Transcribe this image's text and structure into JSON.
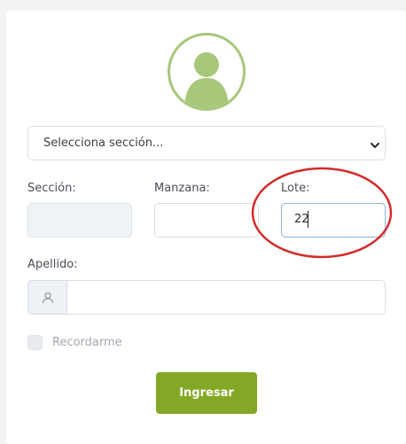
{
  "form": {
    "section_select": {
      "placeholder": "Selecciona sección..."
    },
    "fields": {
      "seccion": {
        "label": "Sección:",
        "value": ""
      },
      "manzana": {
        "label": "Manzana:",
        "value": ""
      },
      "lote": {
        "label": "Lote:",
        "value": "22"
      },
      "apellido": {
        "label": "Apellido:",
        "value": ""
      }
    },
    "remember": {
      "label": "Recordarme"
    },
    "submit": {
      "label": "Ingresar"
    }
  },
  "icons": {
    "avatar": "user-avatar-icon",
    "select_arrow": "chevron-down-icon",
    "apellido_prefix": "user-icon"
  },
  "colors": {
    "accent_green": "#84a825",
    "avatar_green": "#a7c77a",
    "annotation_red": "#d42a2a"
  }
}
